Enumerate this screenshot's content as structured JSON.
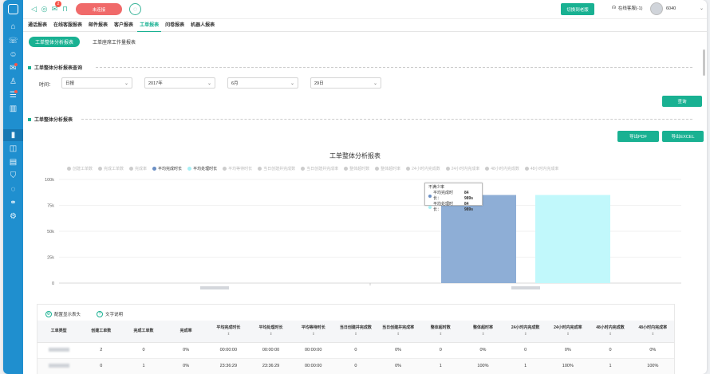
{
  "topbar": {
    "mail_badge": "2",
    "status_label": "未连接",
    "switch_label": "切换到老版",
    "online_label": "在线客服(-1)",
    "user_id": "6040"
  },
  "nav_tabs": [
    "通话报表",
    "在线客服报表",
    "邮件报表",
    "客户报表",
    "工单报表",
    "问卷报表",
    "机器人报表"
  ],
  "sub_tabs": [
    "工单整体分析报表",
    "工单座席工作量报表"
  ],
  "query": {
    "section_title": "工单整体分析报表查询",
    "time_label": "时间：",
    "period": "日报",
    "year": "2017年",
    "month": "6月",
    "day": "29日",
    "search_label": "查询"
  },
  "report": {
    "section_title": "工单整体分析报表",
    "export_pdf": "导出PDF",
    "export_excel": "导出EXCEL"
  },
  "chart_data": {
    "type": "bar",
    "title": "工单整体分析报表",
    "legend": [
      {
        "name": "创建工单数",
        "active": false
      },
      {
        "name": "完成工单数",
        "active": false
      },
      {
        "name": "完成率",
        "active": false
      },
      {
        "name": "平均完成时长",
        "active": true,
        "color": "#6b8fc4"
      },
      {
        "name": "平均处理时长",
        "active": true,
        "color": "#a8f0f5"
      },
      {
        "name": "平均等待时长",
        "active": false
      },
      {
        "name": "当日创建并完成数",
        "active": false
      },
      {
        "name": "当日创建并完成率",
        "active": false
      },
      {
        "name": "整体超时数",
        "active": false
      },
      {
        "name": "整体超时率",
        "active": false
      },
      {
        "name": "24小时内完成数",
        "active": false
      },
      {
        "name": "24小时内完成率",
        "active": false
      },
      {
        "name": "48小时内完成数",
        "active": false
      },
      {
        "name": "48小时内完成率",
        "active": false
      }
    ],
    "y_ticks": [
      "100k",
      "75k",
      "50k",
      "25k",
      "0"
    ],
    "ylim": [
      0,
      100000
    ],
    "series": [
      {
        "name": "平均完成时长",
        "color": "#8eaed6",
        "values": [
          0,
          84989
        ]
      },
      {
        "name": "平均处理时长",
        "color": "#c1f8fb",
        "values": [
          0,
          84989
        ]
      }
    ],
    "tooltip": {
      "title": "不满少率",
      "rows": [
        {
          "label": "平均完成时长：",
          "value": "84 989s",
          "color": "#6b8fc4"
        },
        {
          "label": "平均处理时长：",
          "value": "84 989s",
          "color": "#a8f0f5"
        }
      ]
    }
  },
  "table": {
    "tool_config": "配置显示表头",
    "tool_help": "文字说明",
    "headers": [
      "工单类型",
      "创建工单数",
      "完成工单数",
      "完成率",
      "平均完成时长",
      "平均处理时长",
      "平均等待时长",
      "当日创建并完成数",
      "当日创建并完成率",
      "整体超时数",
      "整体超时率",
      "24小时内完成数",
      "24小时内完成率",
      "48小时内完成数",
      "48小时内完成率"
    ],
    "rows": [
      [
        "2",
        "0",
        "0%",
        "00:00:00",
        "00:00:00",
        "00:00:00",
        "0",
        "0%",
        "0",
        "0%",
        "0",
        "0%",
        "0",
        "0%"
      ],
      [
        "0",
        "1",
        "0%",
        "23:36:29",
        "23:36:29",
        "00:00:00",
        "0",
        "0%",
        "1",
        "100%",
        "1",
        "100%",
        "1",
        "100%"
      ]
    ]
  }
}
